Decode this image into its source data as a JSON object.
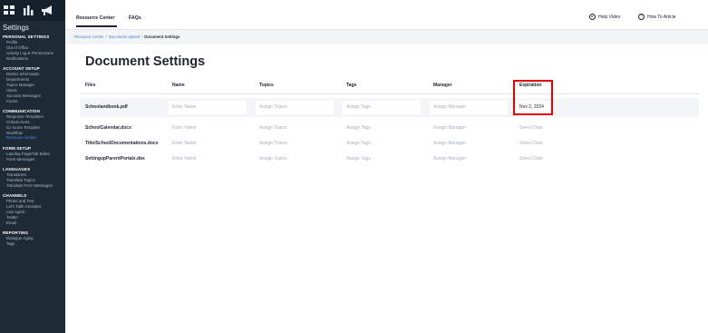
{
  "header": {
    "tabs": [
      {
        "label": "Resource Center"
      },
      {
        "label": "FAQs"
      }
    ],
    "help_video": {
      "icon": "play-circle-icon",
      "label": "Help Video"
    },
    "how_to": {
      "icon": "question-circle-icon",
      "label": "How To Article"
    }
  },
  "sidebar": {
    "title": "Settings",
    "top_icons": [
      "grid-icon",
      "bar-chart-icon",
      "megaphone-icon"
    ],
    "sections": [
      {
        "heading": "PERSONAL SETTINGS",
        "items": [
          "Profile",
          "Out of Office",
          "Activity Log & Permissions",
          "Notifications"
        ]
      },
      {
        "heading": "ACCOUNT SETUP",
        "items": [
          "District Information",
          "Departments",
          "Topics Manager",
          "Users",
          "Success Messages",
          "Forms"
        ]
      },
      {
        "heading": "COMMUNICATION",
        "items": [
          "Response Templates",
          "Critical Alerts",
          "Cx Score Template",
          "Workflow",
          "Resource Center"
        ]
      },
      {
        "heading": "FORM SETUP",
        "items": [
          "Landing Page/Tab Editor",
          "Form Messages"
        ]
      },
      {
        "heading": "LANGUAGES",
        "items": [
          "Translators",
          "Translate Topics",
          "Translate Form Messages"
        ]
      },
      {
        "heading": "CHANNELS",
        "items": [
          "Phone and Text",
          "Let's Talk! Assistant",
          "Live Agent",
          "Twitter",
          "Email"
        ]
      },
      {
        "heading": "REPORTING",
        "items": [
          "Dialogue Aging",
          "Tags"
        ]
      }
    ],
    "active_item": "Resource Center"
  },
  "breadcrumb": {
    "links": [
      "Resource Center",
      "Document Upload"
    ],
    "separator": "/",
    "current": "Document Settings"
  },
  "page": {
    "title": "Document Settings"
  },
  "table": {
    "columns": [
      "Files",
      "Name",
      "Topics",
      "Tags",
      "Manager",
      "Expiration"
    ],
    "rows": [
      {
        "file": "Schoolandbook.pdf",
        "name": "Enter Name",
        "topics": "Assign Topics",
        "tags": "Assign Tags",
        "manager": "Assign Manager",
        "expiration": "Nov 2, 2024"
      },
      {
        "file": "SchoolCalendar.docx",
        "name": "Enter Name",
        "topics": "Assign Topics",
        "tags": "Assign Tags",
        "manager": "Assign Manager",
        "expiration": "Select Date"
      },
      {
        "file": "TitleISchoolDocumentations.docx",
        "name": "Enter Name",
        "topics": "Assign Topics",
        "tags": "Assign Tags",
        "manager": "Assign Manager",
        "expiration": "Select Date"
      },
      {
        "file": "SettingupParentPortals.dox",
        "name": "Enter Name",
        "topics": "Assign Topics",
        "tags": "Assign Tags",
        "manager": "Assign Manager",
        "expiration": "Select Date"
      }
    ]
  },
  "colors": {
    "highlight_box": "#e60000",
    "link": "#3f7fd9",
    "sidebar_bg": "#1e2a36"
  }
}
